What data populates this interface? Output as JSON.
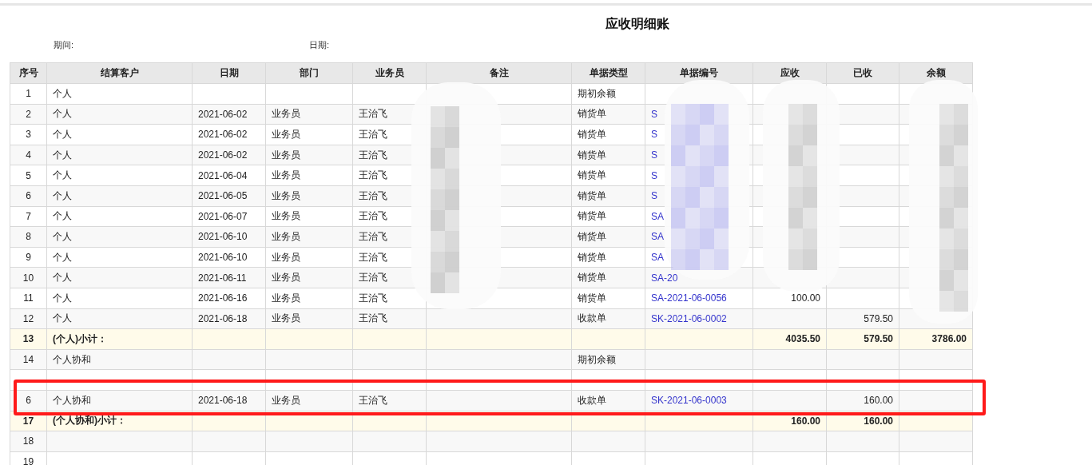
{
  "title": "应收明细账",
  "filters": [
    {
      "label": "期间:"
    },
    {
      "label": "日期:"
    }
  ],
  "columns": [
    "序号",
    "结算客户",
    "日期",
    "部门",
    "业务员",
    "备注",
    "单据类型",
    "单据编号",
    "应收",
    "已收",
    "余额"
  ],
  "rows": [
    {
      "kind": "opening",
      "no": "1",
      "customer": "个人",
      "doc_type": "期初余额"
    },
    {
      "kind": "detail",
      "no": "2",
      "customer": "个人",
      "date": "2021-06-02",
      "dept": "业务员",
      "salesperson": "王治飞",
      "doc_type": "销货单",
      "doc_no": "S"
    },
    {
      "kind": "detail",
      "no": "3",
      "customer": "个人",
      "date": "2021-06-02",
      "dept": "业务员",
      "salesperson": "王治飞",
      "doc_type": "销货单",
      "doc_no": "S"
    },
    {
      "kind": "detail",
      "no": "4",
      "customer": "个人",
      "date": "2021-06-02",
      "dept": "业务员",
      "salesperson": "王治飞",
      "doc_type": "销货单",
      "doc_no": "S"
    },
    {
      "kind": "detail",
      "no": "5",
      "customer": "个人",
      "date": "2021-06-04",
      "dept": "业务员",
      "salesperson": "王治飞",
      "doc_type": "销货单",
      "doc_no": "S"
    },
    {
      "kind": "detail",
      "no": "6",
      "customer": "个人",
      "date": "2021-06-05",
      "dept": "业务员",
      "salesperson": "王治飞",
      "doc_type": "销货单",
      "doc_no": "S"
    },
    {
      "kind": "detail",
      "no": "7",
      "customer": "个人",
      "date": "2021-06-07",
      "dept": "业务员",
      "salesperson": "王治飞",
      "doc_type": "销货单",
      "doc_no": "SA"
    },
    {
      "kind": "detail",
      "no": "8",
      "customer": "个人",
      "date": "2021-06-10",
      "dept": "业务员",
      "salesperson": "王治飞",
      "doc_type": "销货单",
      "doc_no": "SA"
    },
    {
      "kind": "detail",
      "no": "9",
      "customer": "个人",
      "date": "2021-06-10",
      "dept": "业务员",
      "salesperson": "王治飞",
      "doc_type": "销货单",
      "doc_no": "SA"
    },
    {
      "kind": "detail",
      "no": "10",
      "customer": "个人",
      "date": "2021-06-11",
      "dept": "业务员",
      "salesperson": "王治飞",
      "doc_type": "销货单",
      "doc_no": "SA-20"
    },
    {
      "kind": "detail",
      "no": "11",
      "customer": "个人",
      "date": "2021-06-16",
      "dept": "业务员",
      "salesperson": "王治飞",
      "doc_type": "销货单",
      "doc_no": "SA-2021-06-0056",
      "receivable": "100.00"
    },
    {
      "kind": "detail",
      "no": "12",
      "customer": "个人",
      "date": "2021-06-18",
      "dept": "业务员",
      "salesperson": "王治飞",
      "doc_type": "收款单",
      "doc_no": "SK-2021-06-0002",
      "received": "579.50"
    },
    {
      "kind": "subtotal",
      "no": "13",
      "customer": "(个人)小计：",
      "receivable": "4035.50",
      "received": "579.50",
      "balance": "3786.00"
    },
    {
      "kind": "opening",
      "no": "14",
      "customer": "个人协和",
      "doc_type": "期初余额"
    },
    {
      "kind": "empty"
    },
    {
      "kind": "detail",
      "no": "6",
      "customer": "个人协和",
      "date": "2021-06-18",
      "dept": "业务员",
      "salesperson": "王治飞",
      "doc_type": "收款单",
      "doc_no": "SK-2021-06-0003",
      "received": "160.00"
    },
    {
      "kind": "subtotal",
      "no": "17",
      "customer": "(个人协和)小计：",
      "receivable": "160.00",
      "received": "160.00"
    },
    {
      "kind": "empty",
      "no": "18"
    },
    {
      "kind": "empty",
      "no": "19"
    }
  ]
}
